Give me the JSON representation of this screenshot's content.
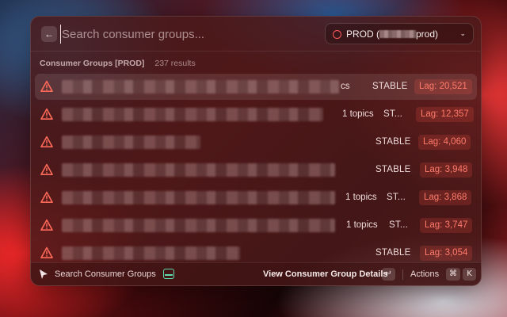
{
  "search": {
    "placeholder": "Search consumer groups...",
    "back_icon": "arrow-left-icon"
  },
  "environment": {
    "label_prefix": "PROD (",
    "label_suffix": "prod)",
    "status_color": "#ff5a5a"
  },
  "section": {
    "title": "Consumer Groups [PROD]",
    "count": "237 results"
  },
  "rows": [
    {
      "topics": "cs",
      "state": "STABLE",
      "lag": "Lag: 20,521",
      "selected": true
    },
    {
      "topics": "1 topics",
      "state": "ST...",
      "lag": "Lag: 12,357",
      "selected": false
    },
    {
      "topics": "",
      "state": "STABLE",
      "lag": "Lag: 4,060",
      "selected": false
    },
    {
      "topics": "",
      "state": "STABLE",
      "lag": "Lag: 3,948",
      "selected": false
    },
    {
      "topics": "1 topics",
      "state": "ST...",
      "lag": "Lag: 3,868",
      "selected": false
    },
    {
      "topics": "1 topics",
      "state": "ST...",
      "lag": "Lag: 3,747",
      "selected": false
    },
    {
      "topics": "",
      "state": "STABLE",
      "lag": "Lag: 3,054",
      "selected": false
    }
  ],
  "footer": {
    "command_label": "Search Consumer Groups",
    "primary_action": "View Consumer Group Details",
    "enter_key": "↵",
    "actions_label": "Actions",
    "cmd_key": "⌘",
    "k_key": "K"
  },
  "colors": {
    "warning": "#ff6a5a",
    "lag_text": "#ff7b6b",
    "extension_accent": "#5fd9b0"
  }
}
